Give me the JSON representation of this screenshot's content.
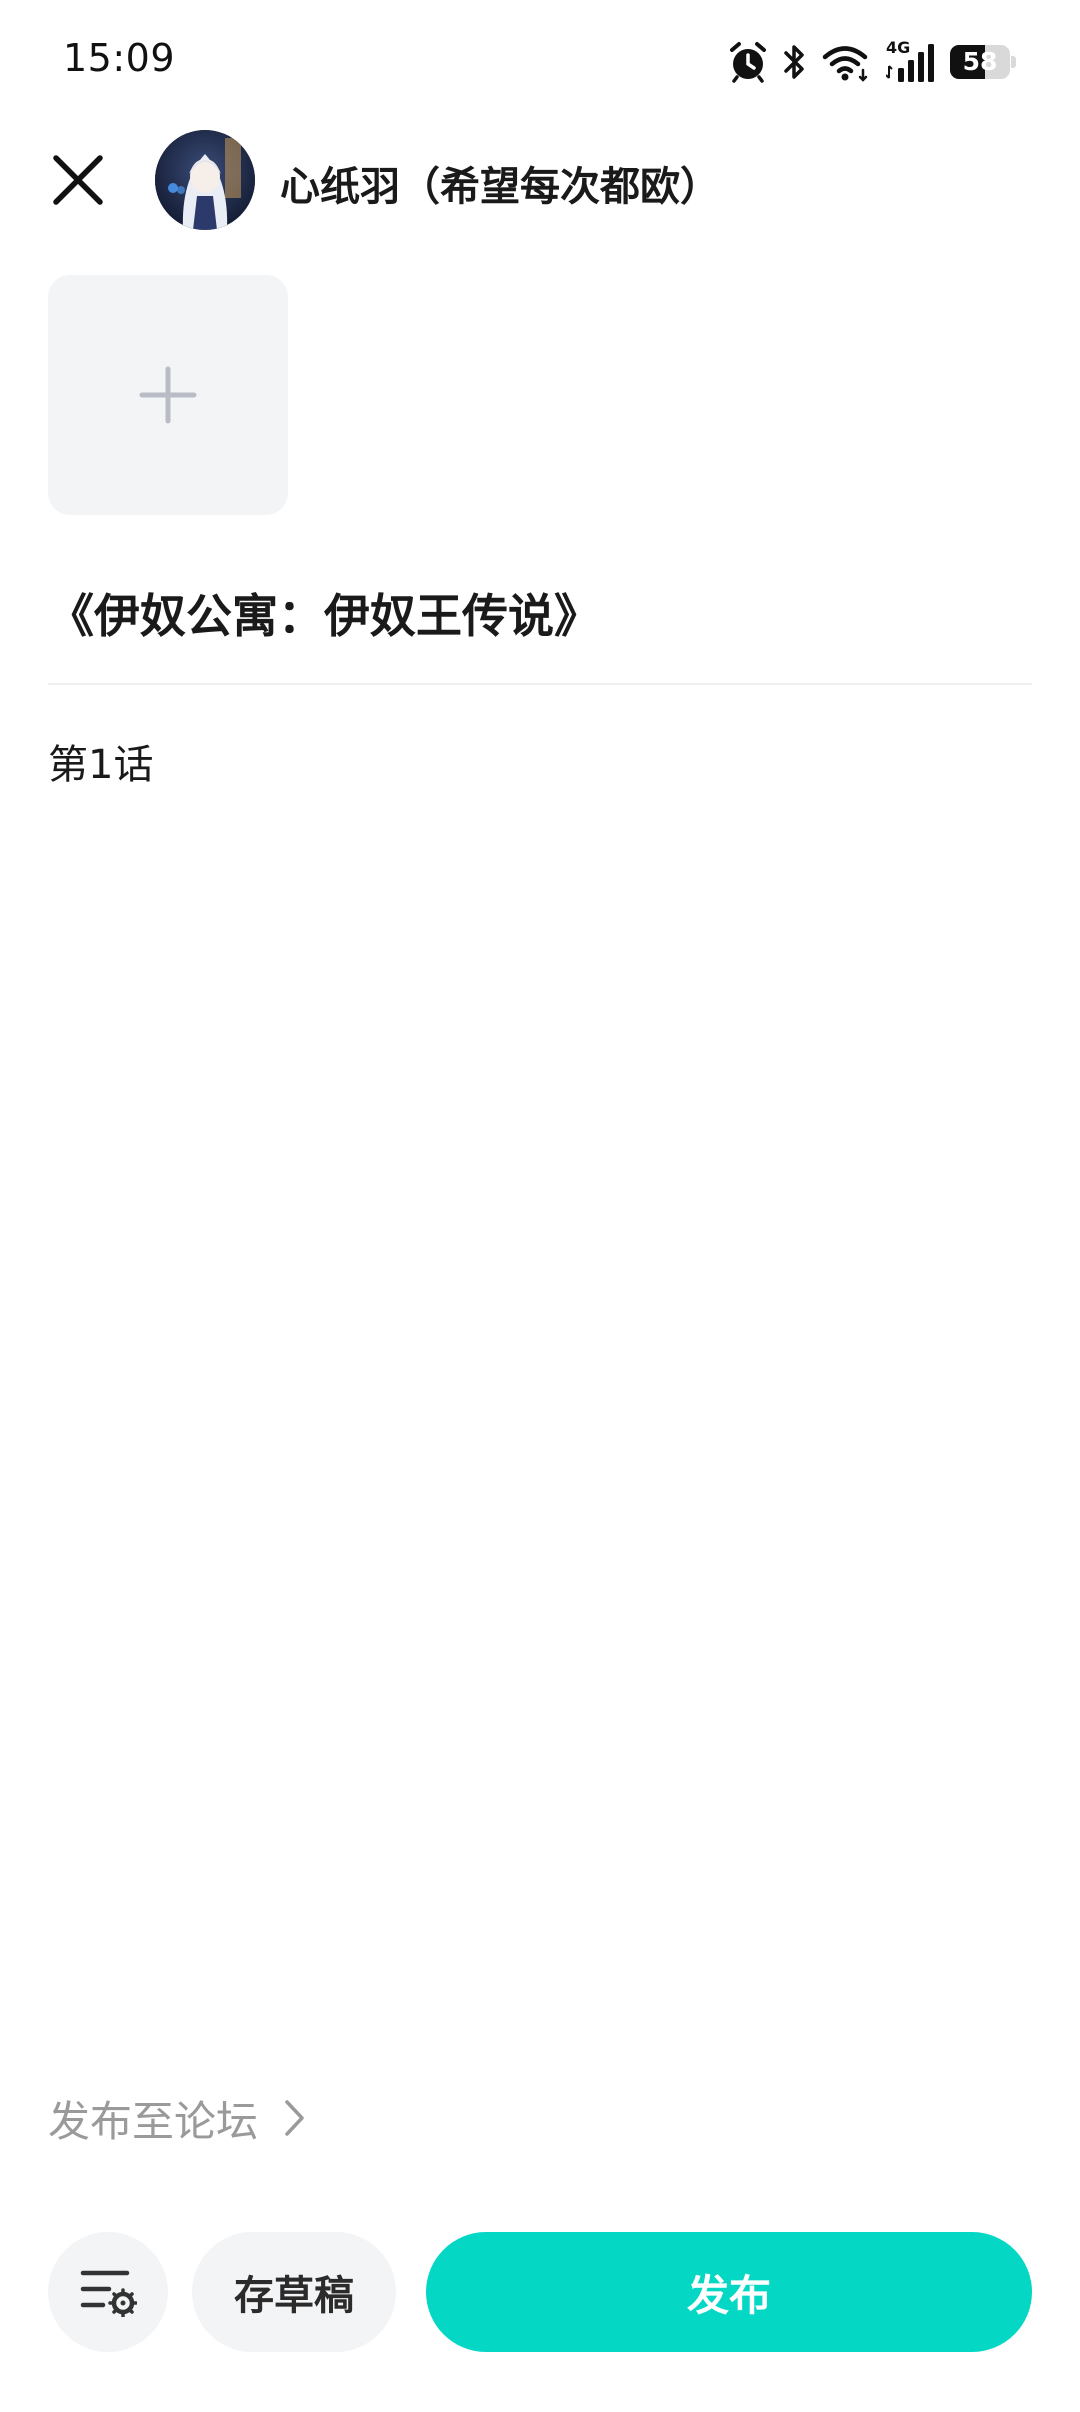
{
  "status_bar": {
    "time": "15:09",
    "battery_level": "58",
    "network_label": "4G",
    "icons": [
      "alarm-icon",
      "bluetooth-icon",
      "wifi-icon",
      "signal-icon",
      "battery-icon"
    ]
  },
  "header": {
    "author_name": "心纸羽（希望每次都欧）"
  },
  "post": {
    "title": "《伊奴公寓：伊奴王传说》",
    "body": "第1话"
  },
  "forum": {
    "label": "发布至论坛"
  },
  "actions": {
    "draft_label": "存草稿",
    "publish_label": "发布"
  },
  "colors": {
    "accent": "#04d8c4",
    "button_bg": "#f3f4f6",
    "muted_text": "#9a9a9a"
  }
}
